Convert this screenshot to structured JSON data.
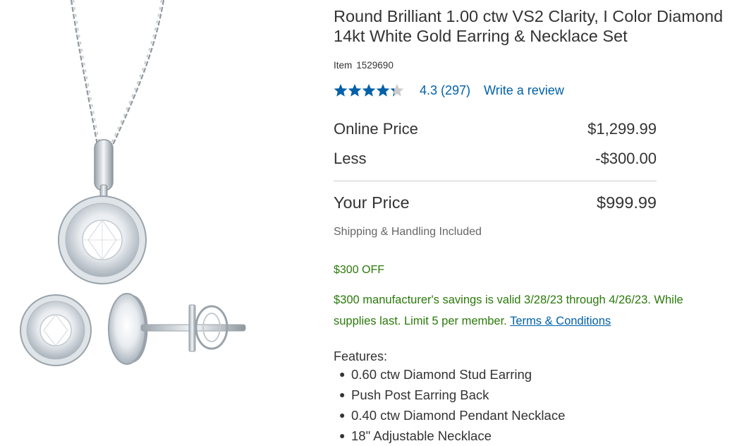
{
  "product": {
    "title": "Round Brilliant 1.00 ctw VS2 Clarity, I Color Diamond 14kt White Gold Earring & Necklace Set",
    "item_label": "Item",
    "item_number": "1529690"
  },
  "rating": {
    "stars": 4.3,
    "text": "4.3  (297)",
    "review_link": "Write a review",
    "star_color": "#0060a9",
    "empty_star_color": "#cccccc"
  },
  "pricing": {
    "online_label": "Online Price",
    "online_value": "$1,299.99",
    "less_label": "Less",
    "less_value": "-$300.00",
    "your_label": "Your Price",
    "your_value": "$999.99",
    "shipping": "Shipping & Handling Included"
  },
  "promo": {
    "off": "$300 OFF",
    "savings_text": "$300 manufacturer's savings is valid 3/28/23 through 4/26/23. While supplies last. Limit 5 per member. ",
    "terms_link": "Terms & Conditions",
    "color": "#2b7a0b"
  },
  "features": {
    "label": "Features:",
    "items": [
      "0.60 ctw Diamond Stud Earring",
      "Push Post Earring Back",
      "0.40 ctw Diamond Pendant Necklace",
      "18\" Adjustable Necklace"
    ]
  }
}
